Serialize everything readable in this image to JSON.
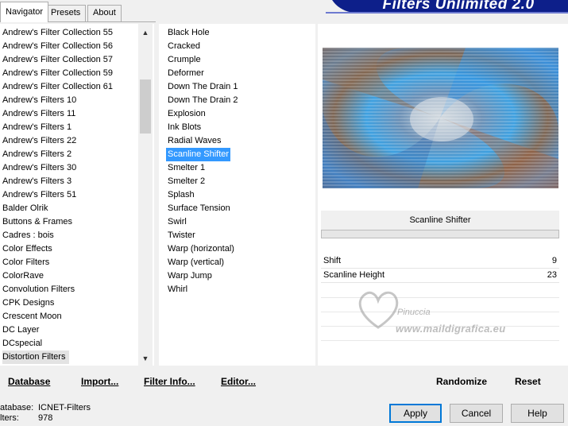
{
  "tabs": [
    {
      "label": "Navigator",
      "active": true
    },
    {
      "label": "Presets",
      "active": false
    },
    {
      "label": "About",
      "active": false
    }
  ],
  "banner_title": "Filters Unlimited 2.0",
  "categories": [
    "Andrew's Filter Collection 55",
    "Andrew's Filter Collection 56",
    "Andrew's Filter Collection 57",
    "Andrew's Filter Collection 59",
    "Andrew's Filter Collection 61",
    "Andrew's Filters 10",
    "Andrew's Filters 11",
    "Andrew's Filters 1",
    "Andrew's Filters 22",
    "Andrew's Filters 2",
    "Andrew's Filters 30",
    "Andrew's Filters 3",
    "Andrew's Filters 51",
    "Balder Olrik",
    "Buttons & Frames",
    "Cadres : bois",
    "Color Effects",
    "Color Filters",
    "ColorRave",
    "Convolution Filters",
    "CPK Designs",
    "Crescent Moon",
    "DC Layer",
    "DCspecial",
    "Distortion Filters"
  ],
  "selected_category": "Distortion Filters",
  "filters": [
    "Black Hole",
    "Cracked",
    "Crumple",
    "Deformer",
    "Down The Drain 1",
    "Down The Drain 2",
    "Explosion",
    "Ink Blots",
    "Radial Waves",
    "Scanline Shifter",
    "Smelter 1",
    "Smelter 2",
    "Splash",
    "Surface Tension",
    "Swirl",
    "Twister",
    "Warp (horizontal)",
    "Warp (vertical)",
    "Warp Jump",
    "Whirl"
  ],
  "selected_filter": "Scanline Shifter",
  "filter_name_display": "Scanline Shifter",
  "params": [
    {
      "label": "Shift",
      "value": "9"
    },
    {
      "label": "Scanline Height",
      "value": "23"
    }
  ],
  "watermark": {
    "line1": "Pinuccia",
    "line2": "www.maildigrafica.eu"
  },
  "bottom_buttons": {
    "database": "Database",
    "import": "Import...",
    "filter_info": "Filter Info...",
    "editor": "Editor...",
    "randomize": "Randomize",
    "reset": "Reset"
  },
  "status": {
    "database_label": "atabase:",
    "database_value": "ICNET-Filters",
    "filters_label": "lters:",
    "filters_value": "978"
  },
  "dialog_buttons": {
    "apply": "Apply",
    "cancel": "Cancel",
    "help": "Help"
  },
  "colors": {
    "selection": "#3399ff",
    "banner": "#0d1f8a",
    "primary_button_border": "#0078d7"
  }
}
